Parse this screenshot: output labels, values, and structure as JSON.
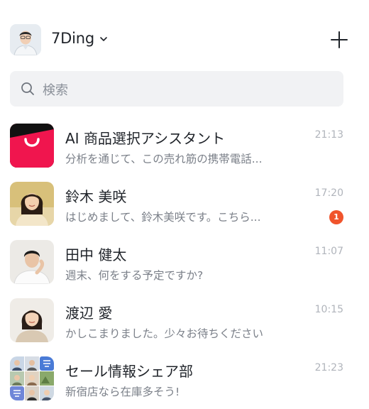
{
  "header": {
    "account_name": "7Ding",
    "avatar_icon": "person-avatar-icon",
    "chevron_icon": "chevron-down-icon",
    "add_icon": "plus-icon"
  },
  "search": {
    "placeholder": "検索",
    "icon": "search-icon"
  },
  "chats": [
    {
      "name": "AI 商品選択アシスタント",
      "preview": "分析を通じて、この売れ筋の携帯電話...",
      "time": "21:13",
      "unread": null,
      "avatar": "shopping-bag-logo"
    },
    {
      "name": "鈴木 美咲",
      "preview": "はじめまして、鈴木美咲です。こちら...",
      "time": "17:20",
      "unread": "1",
      "avatar": "woman-photo"
    },
    {
      "name": "田中 健太",
      "preview": "週末、何をする予定ですか?",
      "time": "11:07",
      "unread": null,
      "avatar": "man-photo"
    },
    {
      "name": "渡辺 愛",
      "preview": "かしこまりました。少々お待ちください",
      "time": "10:15",
      "unread": null,
      "avatar": "woman-photo"
    },
    {
      "name": "セール情報シェア部",
      "preview": "新宿店なら在庫多そう!",
      "time": "21:23",
      "unread": null,
      "avatar": "group-collage"
    }
  ],
  "colors": {
    "accent_red": "#f0154e",
    "badge": "#f0542c",
    "search_bg": "#f1f2f4"
  }
}
